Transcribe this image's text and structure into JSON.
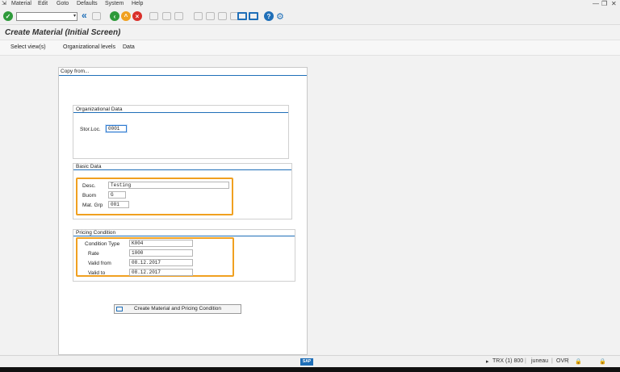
{
  "menu": {
    "items": [
      {
        "label": "Material"
      },
      {
        "label": "Edit"
      },
      {
        "label": "Goto"
      },
      {
        "label": "Defaults"
      },
      {
        "label": "System"
      },
      {
        "label": "Help"
      }
    ]
  },
  "window_controls": {
    "minimize": "—",
    "restore": "❐",
    "close": "✕"
  },
  "toolbar": {
    "command_field_value": "",
    "dropdown_glyph": "▾",
    "back_glyph": "«"
  },
  "title": "Create Material (Initial Screen)",
  "app_toolbar": {
    "select_views": "Select view(s)",
    "org_levels": "Organizational levels",
    "data": "Data"
  },
  "copy_from": {
    "title": "Copy from..."
  },
  "org_data": {
    "title": "Organizational Data",
    "stor_loc_label": "Stor.Loc.",
    "stor_loc_value": "0001"
  },
  "basic_data": {
    "title": "Basic Data",
    "desc_label": "Desc.",
    "desc_value": "Testing",
    "buom_label": "Buom",
    "buom_value": "G",
    "mat_grp_label": "Mat. Grp",
    "mat_grp_value": "001"
  },
  "pricing": {
    "title": "Pricing Condition",
    "cond_type_label": "Condition Type",
    "cond_type_value": "K004",
    "rate_label": "Rate",
    "rate_value": "1000",
    "valid_from_label": "Valid from",
    "valid_from_value": "08.12.2017",
    "valid_to_label": "Valid to",
    "valid_to_value": "08.12.2017"
  },
  "create_button": "Create Material and Pricing Condition",
  "statusbar": {
    "sap_logo": "SAP",
    "system": "TRX (1) 800",
    "user": "juneau",
    "mode": "OVR"
  },
  "colors": {
    "accent": "#1f6fb8",
    "highlight": "#f0a020",
    "ok_green": "#2e9a3a",
    "cancel_red": "#d9302a",
    "exit_orange": "#f0a020"
  }
}
